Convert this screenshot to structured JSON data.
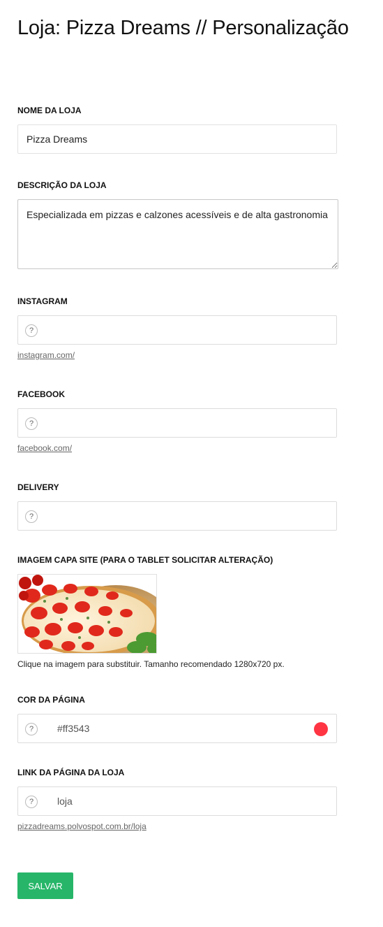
{
  "page": {
    "title": "Loja: Pizza Dreams // Personalização"
  },
  "form": {
    "store_name": {
      "label": "NOME DA LOJA",
      "value": "Pizza Dreams"
    },
    "description": {
      "label": "DESCRIÇÃO DA LOJA",
      "value": "Especializada em pizzas e calzones acessíveis e de alta gastronomia"
    },
    "instagram": {
      "label": "INSTAGRAM",
      "value": "",
      "help": "?",
      "hint": "instagram.com/"
    },
    "facebook": {
      "label": "FACEBOOK",
      "value": "",
      "help": "?",
      "hint": "facebook.com/"
    },
    "delivery": {
      "label": "DELIVERY",
      "value": "",
      "help": "?"
    },
    "cover_image": {
      "label": "IMAGEM CAPA SITE (PARA O TABLET SOLICITAR ALTERAÇÃO)",
      "caption": "Clique na imagem para substituir. Tamanho recomendado 1280x720 px."
    },
    "page_color": {
      "label": "COR DA PÁGINA",
      "value": "#ff3543",
      "help": "?",
      "swatch_color": "#ff3543"
    },
    "store_link": {
      "label": "LINK DA PÁGINA DA LOJA",
      "value": "loja",
      "help": "?",
      "hint": "pizzadreams.polvospot.com.br/loja"
    }
  },
  "actions": {
    "save_label": "SALVAR"
  },
  "colors": {
    "accent_green": "#27b669",
    "page_color": "#ff3543"
  }
}
